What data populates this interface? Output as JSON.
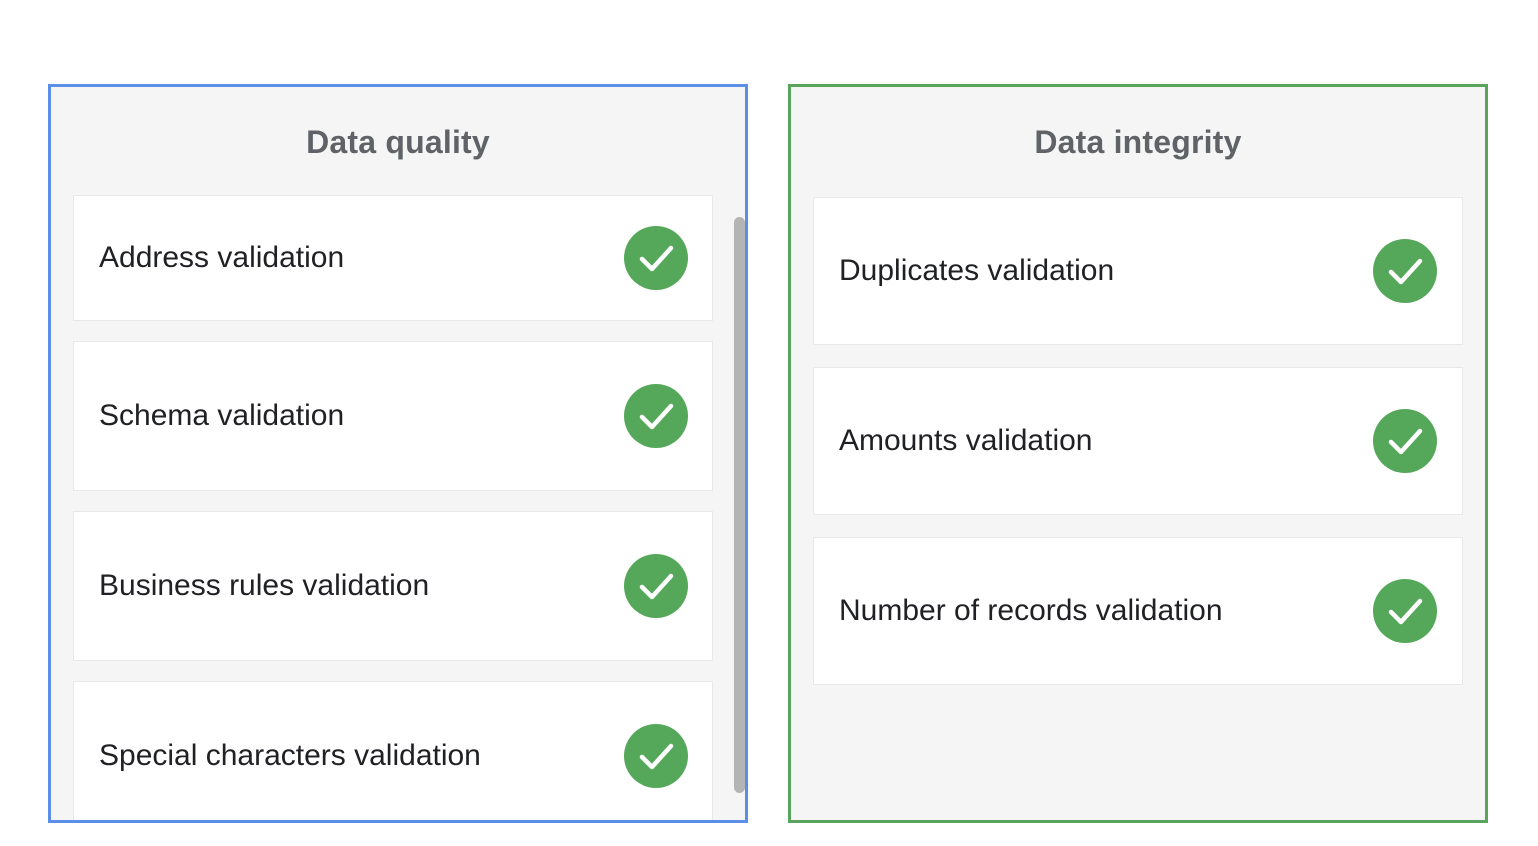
{
  "colors": {
    "quality_border": "#5b8ee6",
    "integrity_border": "#5aa55e",
    "check_fill": "#55a85a"
  },
  "quality": {
    "title": "Data quality",
    "items": [
      {
        "label": "Address validation",
        "icon": "check-circle-icon"
      },
      {
        "label": "Schema validation",
        "icon": "check-circle-icon"
      },
      {
        "label": "Business rules validation",
        "icon": "check-circle-icon"
      },
      {
        "label": "Special characters validation",
        "icon": "check-circle-icon"
      }
    ]
  },
  "integrity": {
    "title": "Data integrity",
    "items": [
      {
        "label": "Duplicates validation",
        "icon": "check-circle-icon"
      },
      {
        "label": "Amounts validation",
        "icon": "check-circle-icon"
      },
      {
        "label": "Number of records validation",
        "icon": "check-circle-icon"
      }
    ]
  }
}
